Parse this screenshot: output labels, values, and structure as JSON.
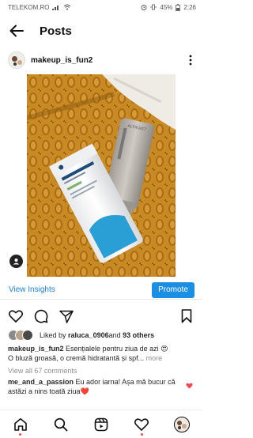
{
  "status_bar": {
    "carrier": "TELEKOM.RO",
    "battery": "45%",
    "time": "2:26"
  },
  "header": {
    "title": "Posts"
  },
  "post": {
    "username": "makeup_is_fun2",
    "view_insights_label": "View Insights",
    "promote_label": "Promote",
    "likes": {
      "prefix": "Liked by ",
      "user": "raluca_0906",
      "middle": " and ",
      "others": "93 others"
    },
    "caption": {
      "username": "makeup_is_fun2",
      "text": " Esențialele pentru ziua de azi 😍",
      "line2": "O bluză groasă, o cremă hidratantă și spf...",
      "more_label": " more"
    },
    "view_comments_label": "View all 67 comments",
    "comment": {
      "username": "me_and_a_passion",
      "text": " Eu ador iarna! Așa mă bucur că astăzi a nins toată ziua❤️"
    }
  },
  "icons": {
    "back": "arrow-left-icon",
    "more": "three-dots-vertical-icon",
    "like": "heart-outline-icon",
    "comment": "speech-bubble-icon",
    "share": "paper-plane-icon",
    "save": "bookmark-icon",
    "nav": [
      "home-icon",
      "search-icon",
      "reels-icon",
      "heart-icon",
      "profile-avatar"
    ]
  },
  "colors": {
    "accent_blue": "#1a8fe3",
    "insights_link": "#1d7fd4",
    "notification_red": "#ed4956"
  }
}
